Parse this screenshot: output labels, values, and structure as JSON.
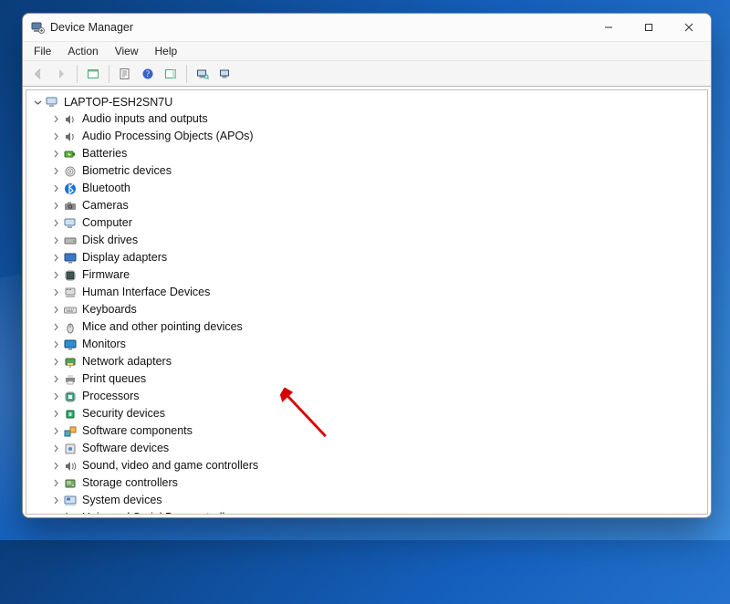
{
  "window": {
    "title": "Device Manager"
  },
  "menu": {
    "file": "File",
    "action": "Action",
    "view": "View",
    "help": "Help"
  },
  "toolbar": {
    "back": "back",
    "forward": "forward",
    "up_tree": "show-hidden",
    "properties": "properties",
    "help_btn": "help",
    "refresh": "scan-hardware",
    "add_legacy": "add-legacy",
    "devices": "devices-view"
  },
  "tree": {
    "root_label": "LAPTOP-ESH2SN7U",
    "nodes": [
      {
        "label": "Audio inputs and outputs",
        "icon": "speaker"
      },
      {
        "label": "Audio Processing Objects (APOs)",
        "icon": "speaker"
      },
      {
        "label": "Batteries",
        "icon": "battery"
      },
      {
        "label": "Biometric devices",
        "icon": "fingerprint"
      },
      {
        "label": "Bluetooth",
        "icon": "bluetooth"
      },
      {
        "label": "Cameras",
        "icon": "camera"
      },
      {
        "label": "Computer",
        "icon": "computer"
      },
      {
        "label": "Disk drives",
        "icon": "disk"
      },
      {
        "label": "Display adapters",
        "icon": "display"
      },
      {
        "label": "Firmware",
        "icon": "chip"
      },
      {
        "label": "Human Interface Devices",
        "icon": "hid"
      },
      {
        "label": "Keyboards",
        "icon": "keyboard"
      },
      {
        "label": "Mice and other pointing devices",
        "icon": "mouse"
      },
      {
        "label": "Monitors",
        "icon": "monitor"
      },
      {
        "label": "Network adapters",
        "icon": "network"
      },
      {
        "label": "Print queues",
        "icon": "printer"
      },
      {
        "label": "Processors",
        "icon": "cpu"
      },
      {
        "label": "Security devices",
        "icon": "security"
      },
      {
        "label": "Software components",
        "icon": "swcomp"
      },
      {
        "label": "Software devices",
        "icon": "swdev"
      },
      {
        "label": "Sound, video and game controllers",
        "icon": "sound"
      },
      {
        "label": "Storage controllers",
        "icon": "storage"
      },
      {
        "label": "System devices",
        "icon": "system"
      },
      {
        "label": "Universal Serial Bus controllers",
        "icon": "usb"
      }
    ]
  },
  "annotation": {
    "arrow_target_index": 20
  }
}
